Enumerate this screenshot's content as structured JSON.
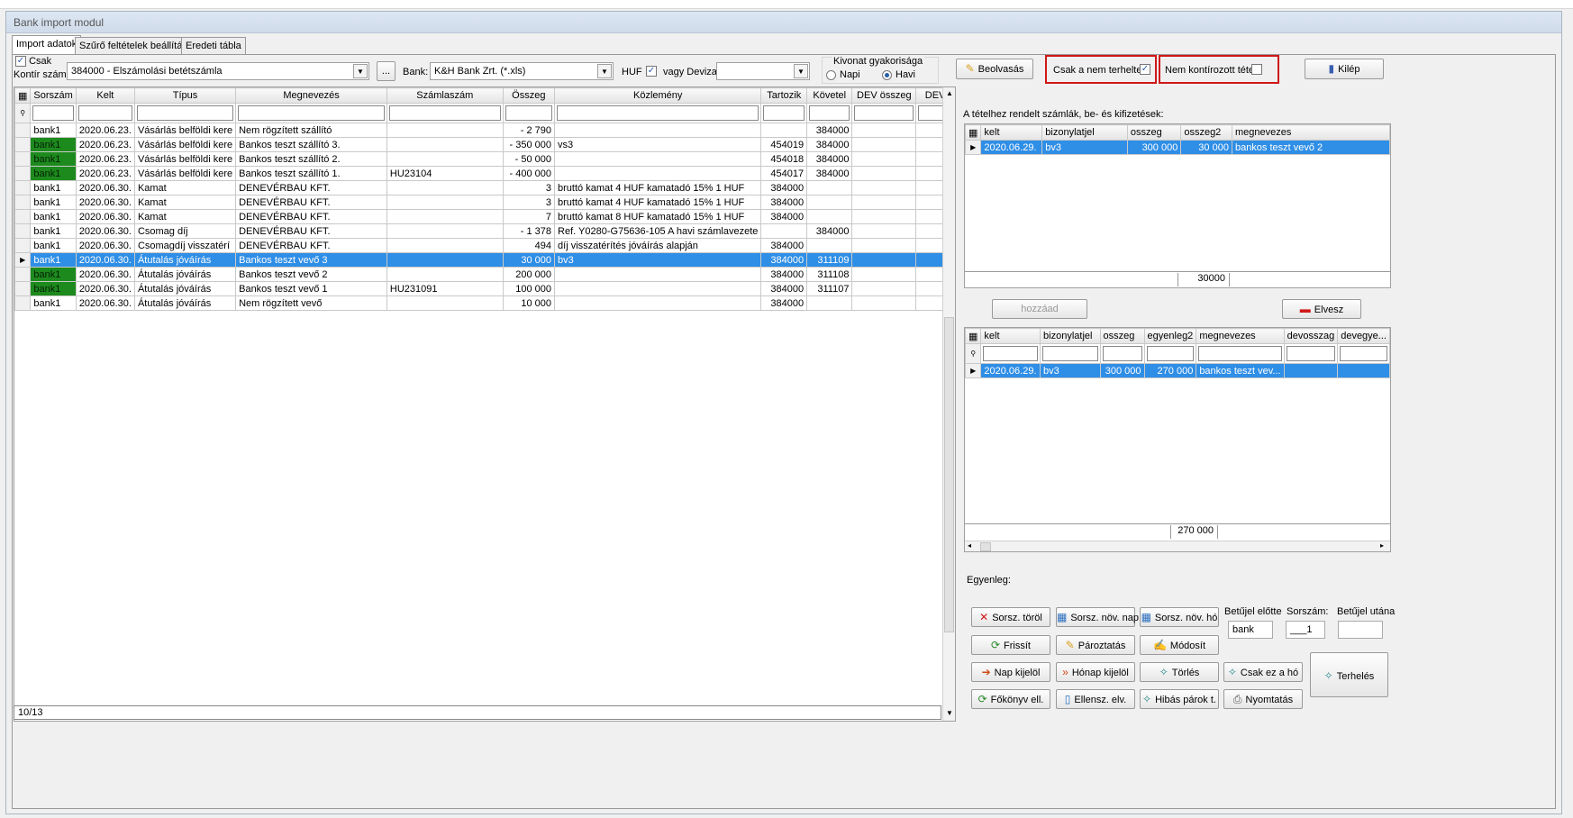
{
  "window": {
    "title": "Bank import modul"
  },
  "tabs": [
    "Import adatok",
    "Szűrő feltételek beállítása",
    "Eredeti tábla"
  ],
  "top": {
    "csak_label": "Csak",
    "kontir_label": "Kontír szám:",
    "kontir_value": "384000 - Elszámolási betétszámla",
    "ellipsis": "...",
    "bank_label": "Bank:",
    "bank_value": "K&H Bank Zrt. (*.xls)",
    "huf_label": "HUF",
    "deviza_label": "vagy Deviza:",
    "deviza_value": "",
    "kivonat_label": "Kivonat gyakorisága",
    "napi_label": "Napi",
    "havi_label": "Havi",
    "beolvasas": "Beolvasás",
    "csak_nem_terheltek": "Csak a nem terheltek",
    "nem_kontirozott": "Nem kontírozott tétel.",
    "kilep": "Kilép"
  },
  "main_grid": {
    "columns": [
      "Sorszám",
      "Kelt",
      "Típus",
      "Megnevezés",
      "Számlaszám",
      "Összeg",
      "Közlemény",
      "Tartozik",
      "Követel",
      "DEV összeg",
      "DEV"
    ],
    "rows": [
      {
        "sorszam": "bank1",
        "kelt": "2020.06.23.",
        "tipus": "Vásárlás belföldi kere",
        "megnevezes": "Nem rögzített szállító",
        "szamlaszam": "",
        "osszeg": "- 2 790",
        "kozlemeny": "",
        "tartozik": "",
        "kovetel": "384000",
        "green": false
      },
      {
        "sorszam": "bank1",
        "kelt": "2020.06.23.",
        "tipus": "Vásárlás belföldi kere",
        "megnevezes": "Bankos teszt szállító 3.",
        "szamlaszam": "",
        "osszeg": "- 350 000",
        "kozlemeny": "vs3",
        "tartozik": "454019",
        "kovetel": "384000",
        "green": true
      },
      {
        "sorszam": "bank1",
        "kelt": "2020.06.23.",
        "tipus": "Vásárlás belföldi kere",
        "megnevezes": "Bankos teszt szállító 2.",
        "szamlaszam": "",
        "osszeg": "- 50 000",
        "kozlemeny": "",
        "tartozik": "454018",
        "kovetel": "384000",
        "green": true
      },
      {
        "sorszam": "bank1",
        "kelt": "2020.06.23.",
        "tipus": "Vásárlás belföldi kere",
        "megnevezes": "Bankos teszt szállító 1.",
        "szamlaszam": "HU23104",
        "osszeg": "- 400 000",
        "kozlemeny": "",
        "tartozik": "454017",
        "kovetel": "384000",
        "green": true
      },
      {
        "sorszam": "bank1",
        "kelt": "2020.06.30.",
        "tipus": "Kamat",
        "megnevezes": "DENEVÉRBAU KFT.",
        "szamlaszam": "",
        "osszeg": "3",
        "kozlemeny": "bruttó kamat 4 HUF kamatadó 15% 1 HUF",
        "tartozik": "384000",
        "kovetel": "",
        "green": false
      },
      {
        "sorszam": "bank1",
        "kelt": "2020.06.30.",
        "tipus": "Kamat",
        "megnevezes": "DENEVÉRBAU KFT.",
        "szamlaszam": "",
        "osszeg": "3",
        "kozlemeny": "bruttó kamat 4 HUF kamatadó 15% 1 HUF",
        "tartozik": "384000",
        "kovetel": "",
        "green": false
      },
      {
        "sorszam": "bank1",
        "kelt": "2020.06.30.",
        "tipus": "Kamat",
        "megnevezes": "DENEVÉRBAU KFT.",
        "szamlaszam": "",
        "osszeg": "7",
        "kozlemeny": "bruttó kamat 8 HUF kamatadó 15% 1 HUF",
        "tartozik": "384000",
        "kovetel": "",
        "green": false
      },
      {
        "sorszam": "bank1",
        "kelt": "2020.06.30.",
        "tipus": "Csomag díj",
        "megnevezes": "DENEVÉRBAU KFT.",
        "szamlaszam": "",
        "osszeg": "- 1 378",
        "kozlemeny": "Ref. Y0280-G75636-105 A havi számlavezete",
        "tartozik": "",
        "kovetel": "384000",
        "green": false
      },
      {
        "sorszam": "bank1",
        "kelt": "2020.06.30.",
        "tipus": "Csomagdíj visszatérí",
        "megnevezes": "DENEVÉRBAU KFT.",
        "szamlaszam": "",
        "osszeg": "494",
        "kozlemeny": "díj visszatérítés jóváírás alapján",
        "tartozik": "384000",
        "kovetel": "",
        "green": false
      },
      {
        "sorszam": "bank1",
        "kelt": "2020.06.30.",
        "tipus": "Átutalás jóváírás",
        "megnevezes": "Bankos teszt vevő 3",
        "szamlaszam": "",
        "osszeg": "30 000",
        "kozlemeny": "bv3",
        "tartozik": "384000",
        "kovetel": "311109",
        "green": true,
        "selected": true
      },
      {
        "sorszam": "bank1",
        "kelt": "2020.06.30.",
        "tipus": "Átutalás jóváírás",
        "megnevezes": "Bankos teszt vevő 2",
        "szamlaszam": "",
        "osszeg": "200 000",
        "kozlemeny": "",
        "tartozik": "384000",
        "kovetel": "311108",
        "green": true
      },
      {
        "sorszam": "bank1",
        "kelt": "2020.06.30.",
        "tipus": "Átutalás jóváírás",
        "megnevezes": "Bankos teszt vevő 1",
        "szamlaszam": "HU231091",
        "osszeg": "100 000",
        "kozlemeny": "",
        "tartozik": "384000",
        "kovetel": "311107",
        "green": true
      },
      {
        "sorszam": "bank1",
        "kelt": "2020.06.30.",
        "tipus": "Átutalás jóváírás",
        "megnevezes": "Nem rögzített vevő",
        "szamlaszam": "",
        "osszeg": "10 000",
        "kozlemeny": "",
        "tartozik": "384000",
        "kovetel": "",
        "green": false
      }
    ],
    "status": "10/13"
  },
  "right": {
    "assigned_label": "A tételhez rendelt számlák, be- és kifizetések:",
    "grid1": {
      "columns": [
        "kelt",
        "bizonylatjel",
        "osszeg",
        "osszeg2",
        "megnevezes"
      ],
      "rows": [
        {
          "kelt": "2020.06.29.",
          "bizonylatjel": "bv3",
          "osszeg": "300 000",
          "osszeg2": "30 000",
          "megnevezes": "bankos teszt vevő 2"
        }
      ],
      "footer_total": "30000"
    },
    "hozzaad": "hozzáad",
    "elvesz": "Elvesz",
    "grid2": {
      "columns": [
        "kelt",
        "bizonylatjel",
        "osszeg",
        "egyenleg2",
        "megnevezes",
        "devosszag",
        "devegye..."
      ],
      "rows": [
        {
          "kelt": "2020.06.29.",
          "bizonylatjel": "bv3",
          "osszeg": "300 000",
          "egyenleg2": "270 000",
          "megnevezes": "bankos teszt vev...",
          "devosszag": "",
          "devegye": ""
        }
      ],
      "footer_total": "270 000"
    },
    "egyenleg_label": "Egyenleg:",
    "buttons": {
      "sorsz_torol": "Sorsz. töröl",
      "sorsz_nov_nap": "Sorsz. növ. nap",
      "sorsz_nov_ho": "Sorsz. növ. hó",
      "frissit": "Frissít",
      "paroztatas": "Pároztatás",
      "modosit": "Módosít",
      "nap_kijelol": "Nap kijelöl",
      "honap_kijelol": "Hónap kijelöl",
      "torles": "Törlés",
      "csak_ez_a_ho": "Csak ez a hó",
      "fokonyv_ell": "Főkönyv ell.",
      "ellensz_elv": "Ellensz. elv.",
      "hibas_parok": "Hibás párok t.",
      "nyomtatas": "Nyomtatás",
      "terheles": "Terhelés"
    },
    "betujel_elotte_label": "Betűjel előtte",
    "betujel_elotte_value": "bank",
    "sorszam_label": "Sorszám:",
    "sorszam_value": "___1",
    "betujel_utana_label": "Betűjel utána",
    "betujel_utana_value": ""
  },
  "colors": {
    "selection": "#2f8ee6",
    "paired_green": "#1d8a1d",
    "highlight_red": "#d01818"
  }
}
